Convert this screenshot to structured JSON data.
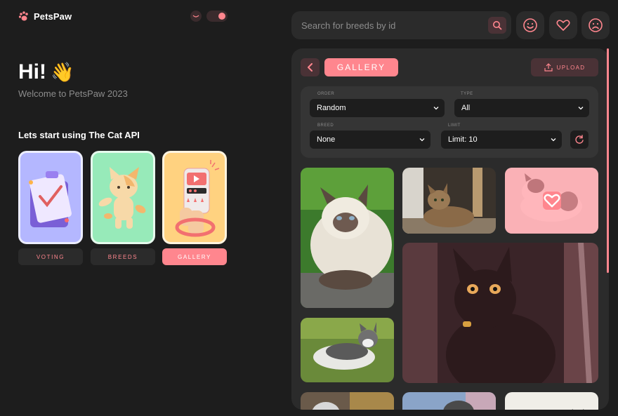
{
  "brand": {
    "name": "PetsPaw"
  },
  "theme": {
    "icon": "eye-icon",
    "toggle_state": "dark"
  },
  "hero": {
    "title": "Hi!",
    "emoji": "👋",
    "subtitle": "Welcome to PetsPaw 2023",
    "cta": "Lets start using The Cat API"
  },
  "nav": [
    {
      "label": "VOTING",
      "icon": "clipboard-illustration",
      "active": false
    },
    {
      "label": "BREEDS",
      "icon": "cat-illustration",
      "active": false
    },
    {
      "label": "GALLERY",
      "icon": "phone-hand-illustration",
      "active": true
    }
  ],
  "search": {
    "placeholder": "Search for breeds by id",
    "icon": "search-icon"
  },
  "quick_actions": [
    {
      "name": "likes",
      "icon": "smile-icon"
    },
    {
      "name": "favourites",
      "icon": "heart-icon"
    },
    {
      "name": "dislikes",
      "icon": "sad-icon"
    }
  ],
  "gallery": {
    "back_icon": "chevron-left-icon",
    "title": "GALLERY",
    "upload_label": "UPLOAD",
    "upload_icon": "upload-icon",
    "filters": {
      "order": {
        "label": "ORDER",
        "value": "Random"
      },
      "type": {
        "label": "TYPE",
        "value": "All"
      },
      "breed": {
        "label": "BREED",
        "value": "None"
      },
      "limit": {
        "label": "LIMIT",
        "value": "Limit: 10"
      }
    },
    "refresh_icon": "refresh-icon",
    "images": [
      {
        "name": "cat-image-1",
        "alt": "fluffy colorpoint cat"
      },
      {
        "name": "cat-image-2",
        "alt": "tabby cat indoors"
      },
      {
        "name": "cat-image-3",
        "alt": "white cat",
        "favourite_hover": true
      },
      {
        "name": "cat-image-4",
        "alt": "tabby and white cat on grass"
      },
      {
        "name": "cat-image-5",
        "alt": "black cat with collar"
      },
      {
        "name": "cat-image-6",
        "alt": "cat"
      },
      {
        "name": "cat-image-7",
        "alt": "cat"
      },
      {
        "name": "cat-image-8",
        "alt": "cat"
      }
    ]
  },
  "colors": {
    "accent": "#ff868e",
    "background": "#1d1d1d",
    "panel": "#2b2b2b"
  }
}
